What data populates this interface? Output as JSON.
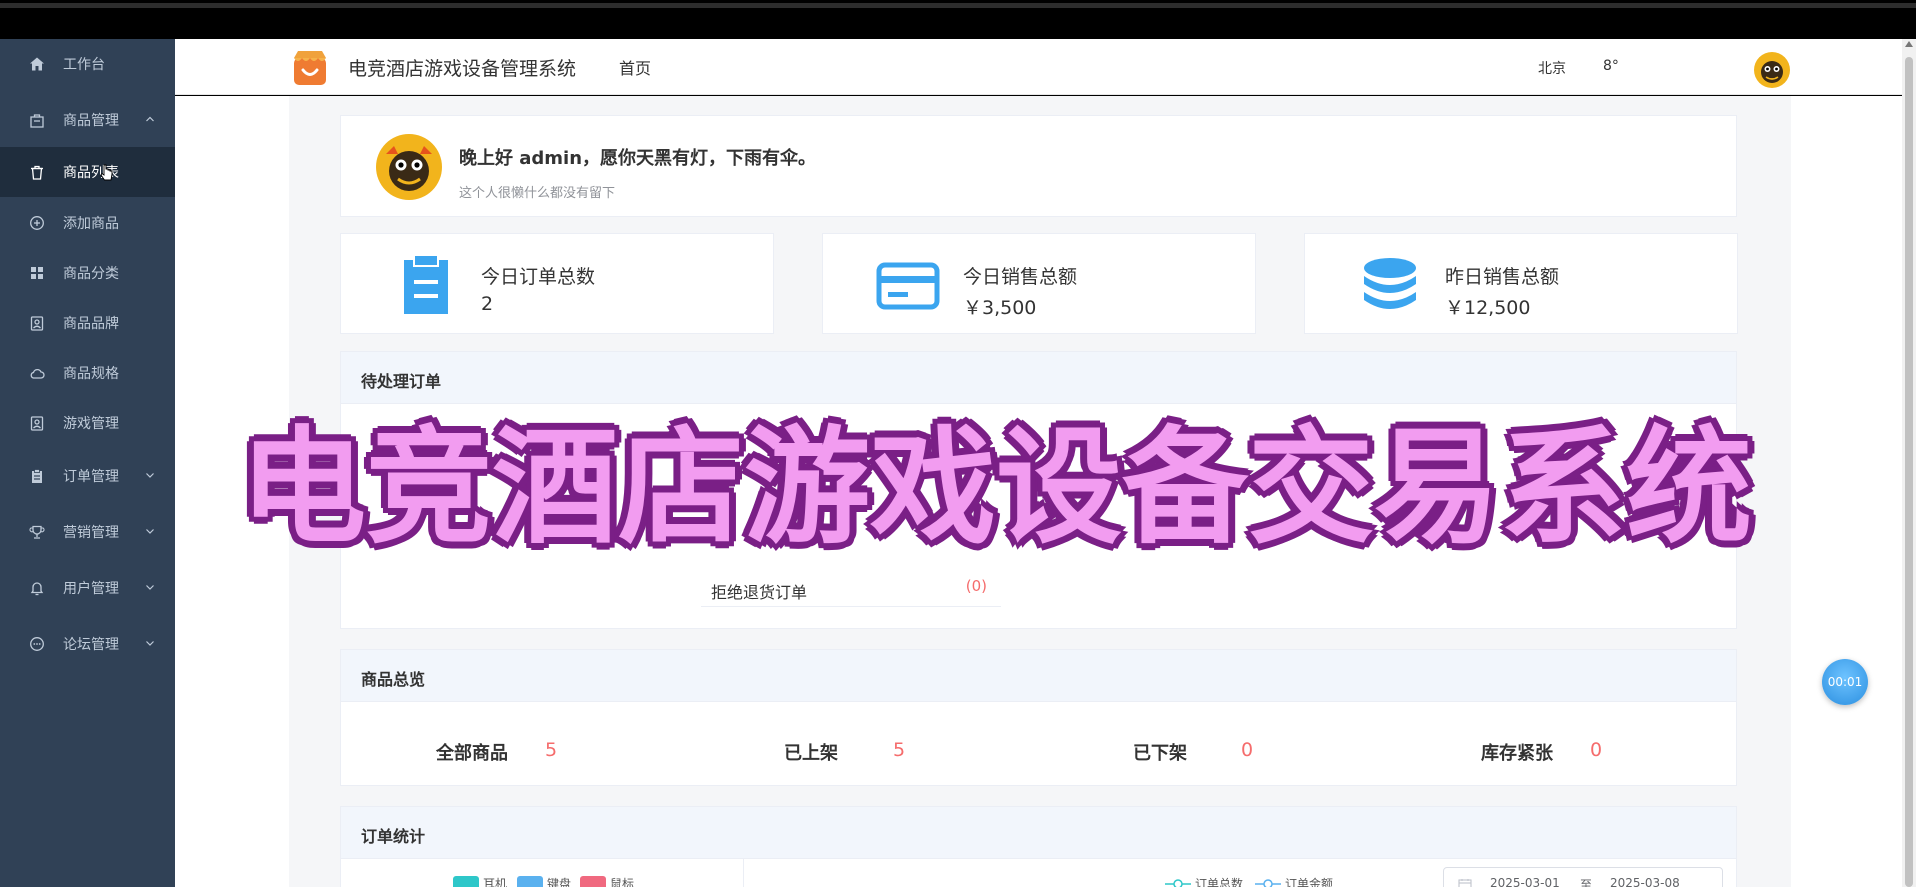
{
  "app": {
    "title": "电竞酒店游戏设备管理系统",
    "home_link": "首页",
    "weather_city": "北京",
    "weather_temp": "8°"
  },
  "sidebar": {
    "items": [
      {
        "label": "工作台",
        "icon": "home-icon"
      },
      {
        "label": "商品管理",
        "icon": "bag-icon",
        "expanded": true
      },
      {
        "label": "商品列表",
        "icon": "trash-icon",
        "active": true
      },
      {
        "label": "添加商品",
        "icon": "plus-circle-icon"
      },
      {
        "label": "商品分类",
        "icon": "grid-icon"
      },
      {
        "label": "商品品牌",
        "icon": "badge-icon"
      },
      {
        "label": "商品规格",
        "icon": "cloud-icon"
      },
      {
        "label": "游戏管理",
        "icon": "badge-icon"
      },
      {
        "label": "订单管理",
        "icon": "clipboard-icon"
      },
      {
        "label": "营销管理",
        "icon": "trophy-icon"
      },
      {
        "label": "用户管理",
        "icon": "bell-icon"
      },
      {
        "label": "论坛管理",
        "icon": "chat-icon"
      }
    ]
  },
  "welcome": {
    "greeting": "晚上好 admin，愿你天黑有灯，下雨有伞。",
    "motto": "这个人很懒什么都没有留下"
  },
  "stats": [
    {
      "label": "今日订单总数",
      "value": "2",
      "icon": "clipboard-icon"
    },
    {
      "label": "今日销售总额",
      "value": "￥3,500",
      "icon": "credit-card-icon"
    },
    {
      "label": "昨日销售总额",
      "value": "￥12,500",
      "icon": "database-icon"
    }
  ],
  "pending_orders": {
    "title": "待处理订单",
    "rows": [
      {
        "label": "拒绝退货订单",
        "value": "(0)"
      }
    ]
  },
  "product_overview": {
    "title": "商品总览",
    "items": [
      {
        "label": "全部商品",
        "value": "5"
      },
      {
        "label": "已上架",
        "value": "5"
      },
      {
        "label": "已下架",
        "value": "0"
      },
      {
        "label": "库存紧张",
        "value": "0"
      }
    ]
  },
  "order_stats": {
    "title": "订单统计",
    "pie_legend": [
      {
        "label": "耳机",
        "color": "#2ec7c9"
      },
      {
        "label": "键盘",
        "color": "#5ab1ef"
      },
      {
        "label": "鼠标",
        "color": "#f0697f"
      }
    ],
    "line_legend": [
      {
        "label": "订单总数"
      },
      {
        "label": "订单金额"
      }
    ],
    "date_start": "2025-03-01",
    "date_sep": "至",
    "date_end": "2025-03-08"
  },
  "overlay": {
    "banner": "电竞酒店游戏设备交易系统",
    "timer": "00:01"
  },
  "colors": {
    "sidebar_bg": "#304156",
    "sidebar_active": "#1f2d3d",
    "accent_blue": "#3ba5ef",
    "value_red": "#f56c6c"
  }
}
